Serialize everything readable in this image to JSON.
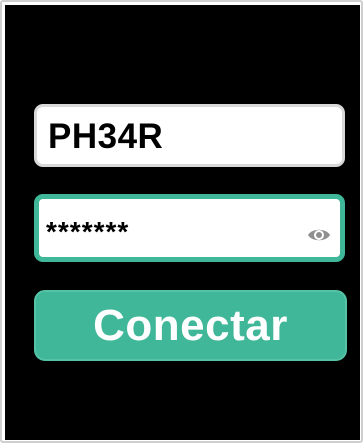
{
  "login": {
    "username_value": "PH34R",
    "password_value": "*******",
    "password_toggle_icon": "eye-icon",
    "connect_label": "Conectar"
  },
  "colors": {
    "screen_background": "#000000",
    "field_background": "#ffffff",
    "accent": "#40b798",
    "button_text": "#ffffff"
  }
}
